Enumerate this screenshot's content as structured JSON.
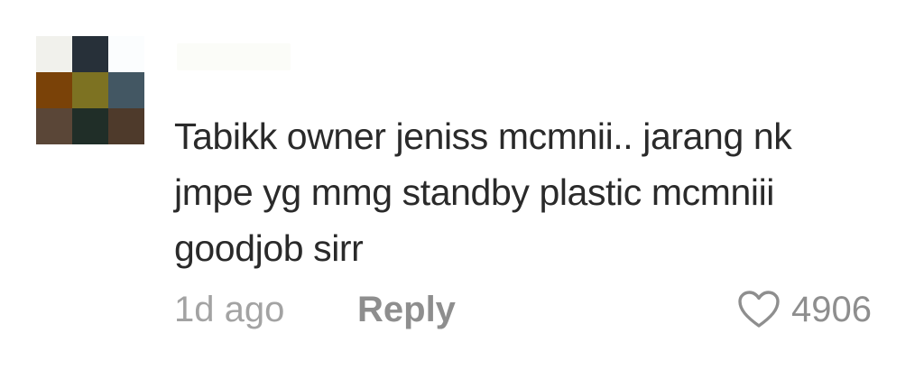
{
  "avatar": {
    "pixels": [
      "#f1f1ec",
      "#273039",
      "#fbfdfe",
      "#7a4208",
      "#7d7222",
      "#435763",
      "#5a4637",
      "#202e28",
      "#4e3a2b"
    ]
  },
  "username": {
    "value": ""
  },
  "comment": {
    "lines": [
      "Tabikk owner jeniss mcmnii.. jarang nk",
      "jmpe yg mmg standby plastic mcmniii",
      "goodjob sirr"
    ],
    "timestamp": "1d ago",
    "reply_label": "Reply",
    "like_count": "4906",
    "like_icon": "heart-outline-icon"
  },
  "colors": {
    "text": "#2a2a2a",
    "meta": "#a3a3a3",
    "reply": "#8e8e8e",
    "icon": "#8e8e8e"
  }
}
